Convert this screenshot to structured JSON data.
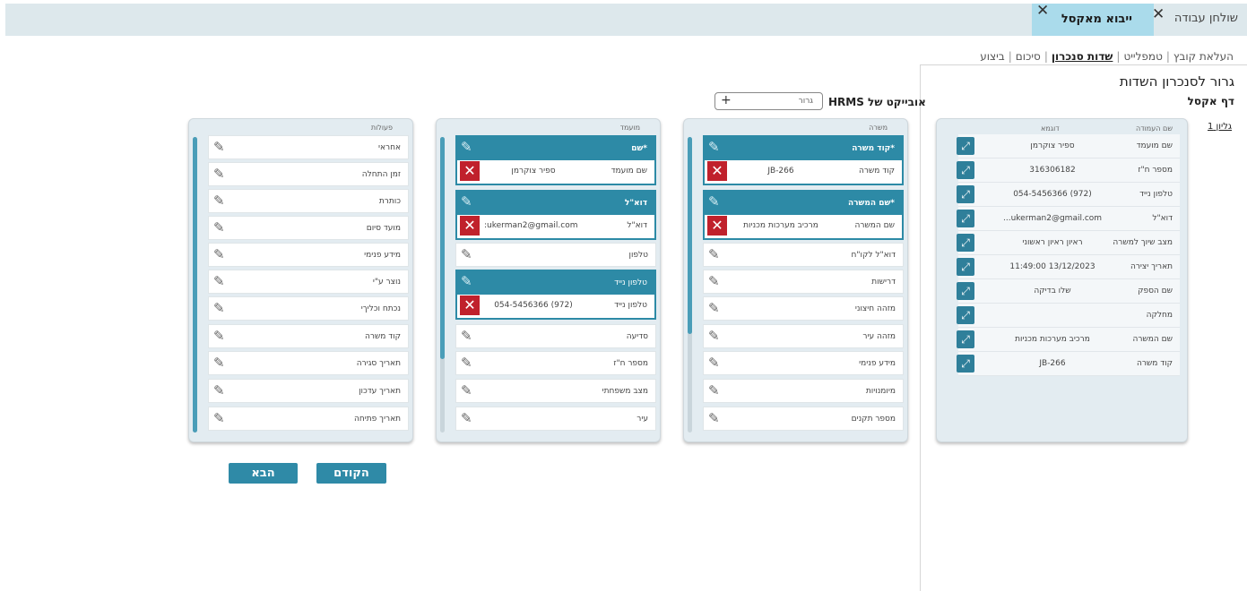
{
  "tabs": {
    "home_label": "שולחן עבודה",
    "active_label": "ייבוא מאקסל"
  },
  "steps": {
    "items": [
      "העלאת קובץ",
      "טמפלייט",
      "שדות סנכרון",
      "סיכום",
      "ביצוע"
    ],
    "current": "שדות סנכרון"
  },
  "panel": {
    "title": "גרור לסנכרון השדות",
    "subtitle": "דף אקסל",
    "sheet_link": "גליון 1"
  },
  "excel": {
    "col_name_header": "שם העמודה",
    "col_example_header": "דוגמא",
    "rows": [
      {
        "name": "שם מועמד",
        "example": "ספיר צוקרמן"
      },
      {
        "name": "מספר ח\"ז",
        "example": "316306182"
      },
      {
        "name": "טלפון נייד",
        "example": "054-5456366 (972)"
      },
      {
        "name": "דוא\"ל",
        "example": "...ukerman2@gmail.com"
      },
      {
        "name": "מצב שיוך למשרה",
        "example": "ראיון ראיון ראשוני"
      },
      {
        "name": "תאריך יצירה",
        "example": "11:49:00 13/12/2023"
      },
      {
        "name": "שם הספק",
        "example": "שלו בדיקה"
      },
      {
        "name": "מחלקה",
        "example": ""
      },
      {
        "name": "שם המשרה",
        "example": "מרכיב מערכות מכניות"
      },
      {
        "name": "קוד משרה",
        "example": "JB-266"
      }
    ]
  },
  "hrms": {
    "label": "אובייקט של HRMS",
    "select_value": "גרור"
  },
  "job_column": {
    "header": "משרה",
    "mapped": [
      {
        "title": "*קוד משרה",
        "field": "קוד משרה",
        "value": "JB-266"
      },
      {
        "title": "*שם המשרה",
        "field": "שם המשרה",
        "value": "מרכיב מערכות מכניות"
      }
    ],
    "rows": [
      "דוא\"ל לקו\"ח",
      "דרישות",
      "מזהה חיצוני",
      "מזהה עיר",
      "מידע פנימי",
      "מיומנויות",
      "מספר תקנים"
    ]
  },
  "candidate_column": {
    "header": "מועמד",
    "mapped_a": [
      {
        "title": "*שם",
        "field": "שם מועמד",
        "value": "ספיר צוקרמן"
      },
      {
        "title": "דוא\"ל",
        "field": "דוא\"ל",
        "value": ":ukerman2@gmail.com"
      }
    ],
    "row_phone": "טלפון",
    "mapped_b": {
      "title": "טלפון נייד",
      "field": "טלפון נייד",
      "value": "054-5456366 (972)"
    },
    "rows": [
      "סדיעה",
      "מספר ח\"ז",
      "מצב משפחתי",
      "עיר"
    ]
  },
  "actions_column": {
    "header": "פעולות",
    "rows": [
      "אחראי",
      "זמן התחלה",
      "כותרת",
      "מועד סיום",
      "מידע פנימי",
      "נוצר ע\"י",
      "נכתח וכליךי",
      "קוד משרה",
      "תאריך סגירה",
      "תאריך עדכון",
      "תאריך פתיחה"
    ]
  },
  "buttons": {
    "prev": "הקודם",
    "next": "הבא"
  }
}
